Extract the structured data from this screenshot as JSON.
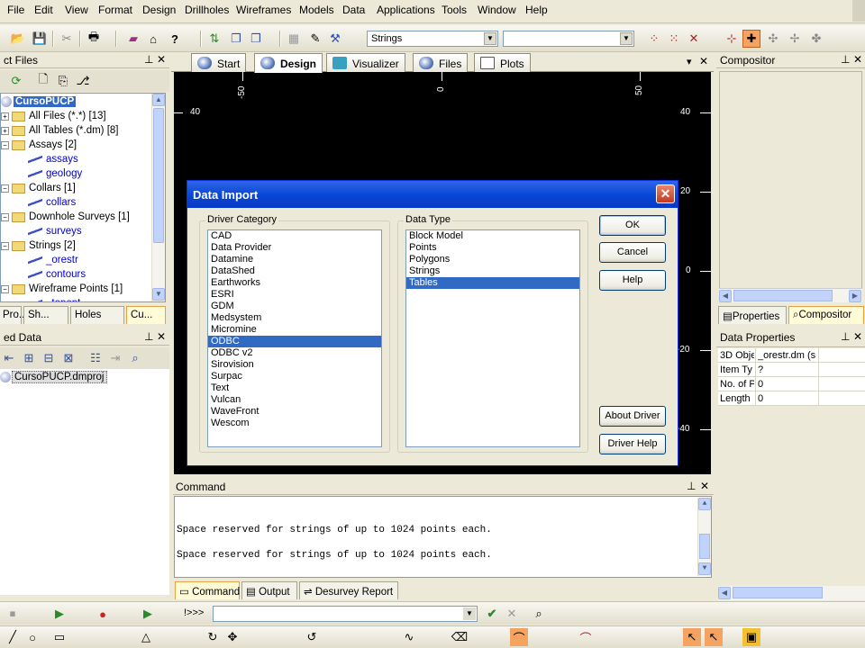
{
  "menu": [
    "File",
    "Edit",
    "View",
    "Format",
    "Design",
    "Drillholes",
    "Wireframes",
    "Models",
    "Data",
    "Applications",
    "Tools",
    "Window",
    "Help"
  ],
  "toolbar": {
    "strings_combo": "Strings",
    "second_combo": ""
  },
  "project_files": {
    "title": "ct Files",
    "items": [
      {
        "label": "CursoPUCP",
        "root": true
      },
      {
        "label": "All Files (*.*) [13]"
      },
      {
        "label": "All Tables (*.dm) [8]"
      },
      {
        "label": "Assays [2]"
      },
      {
        "label": "assays",
        "leaf": true
      },
      {
        "label": "geology",
        "leaf": true
      },
      {
        "label": "Collars [1]"
      },
      {
        "label": "collars",
        "leaf": true
      },
      {
        "label": "Downhole Surveys [1]"
      },
      {
        "label": "surveys",
        "leaf": true
      },
      {
        "label": "Strings [2]"
      },
      {
        "label": "_orestr",
        "leaf": true
      },
      {
        "label": "contours",
        "leaf": true
      },
      {
        "label": "Wireframe Points [1]"
      },
      {
        "label": "_topopt",
        "leaf": true
      }
    ],
    "tabs": [
      "Pro...",
      "Sh...",
      "Holes",
      "Cu..."
    ]
  },
  "loaded_data": {
    "title": "ed Data",
    "item": "CursoPUCP.dmproj"
  },
  "doc_tabs": [
    "Start",
    "Design",
    "Visualizer",
    "Files",
    "Plots"
  ],
  "canvas": {
    "top_ticks": [
      "-50",
      "0",
      "50"
    ],
    "left_ticks": [
      "40"
    ],
    "right_ticks": [
      "40",
      "20",
      "0",
      "-20",
      "-40"
    ]
  },
  "dialog": {
    "title": "Data Import",
    "driver_category_label": "Driver Category",
    "driver_categories": [
      "CAD",
      "Data Provider",
      "Datamine",
      "DataShed",
      "Earthworks",
      "ESRI",
      "GDM",
      "Medsystem",
      "Micromine",
      "ODBC",
      "ODBC v2",
      "Sirovision",
      "Surpac",
      "Text",
      "Vulcan",
      "WaveFront",
      "Wescom"
    ],
    "selected_category": "ODBC",
    "data_type_label": "Data Type",
    "data_types": [
      "Block Model",
      "Points",
      "Polygons",
      "Strings",
      "Tables"
    ],
    "selected_type": "Tables",
    "ok": "OK",
    "cancel": "Cancel",
    "help": "Help",
    "about_driver": "About Driver",
    "driver_help": "Driver Help"
  },
  "command": {
    "title": "Command",
    "lines": [
      "Space reserved for strings of up to 1024 points each.",
      "Space reserved for strings of up to 1024 points each."
    ],
    "tabs": [
      "Command",
      "Output",
      "Desurvey Report"
    ],
    "prompt": "!>>>"
  },
  "compositor": {
    "title": "Compositor",
    "tabs": [
      "Properties",
      "Compositor"
    ]
  },
  "data_properties": {
    "title": "Data Properties",
    "rows": [
      {
        "key": "3D Obje",
        "value": "_orestr.dm (s"
      },
      {
        "key": "Item Ty",
        "value": "?"
      },
      {
        "key": "No. of P",
        "value": "0"
      },
      {
        "key": "Length",
        "value": "0"
      }
    ]
  }
}
